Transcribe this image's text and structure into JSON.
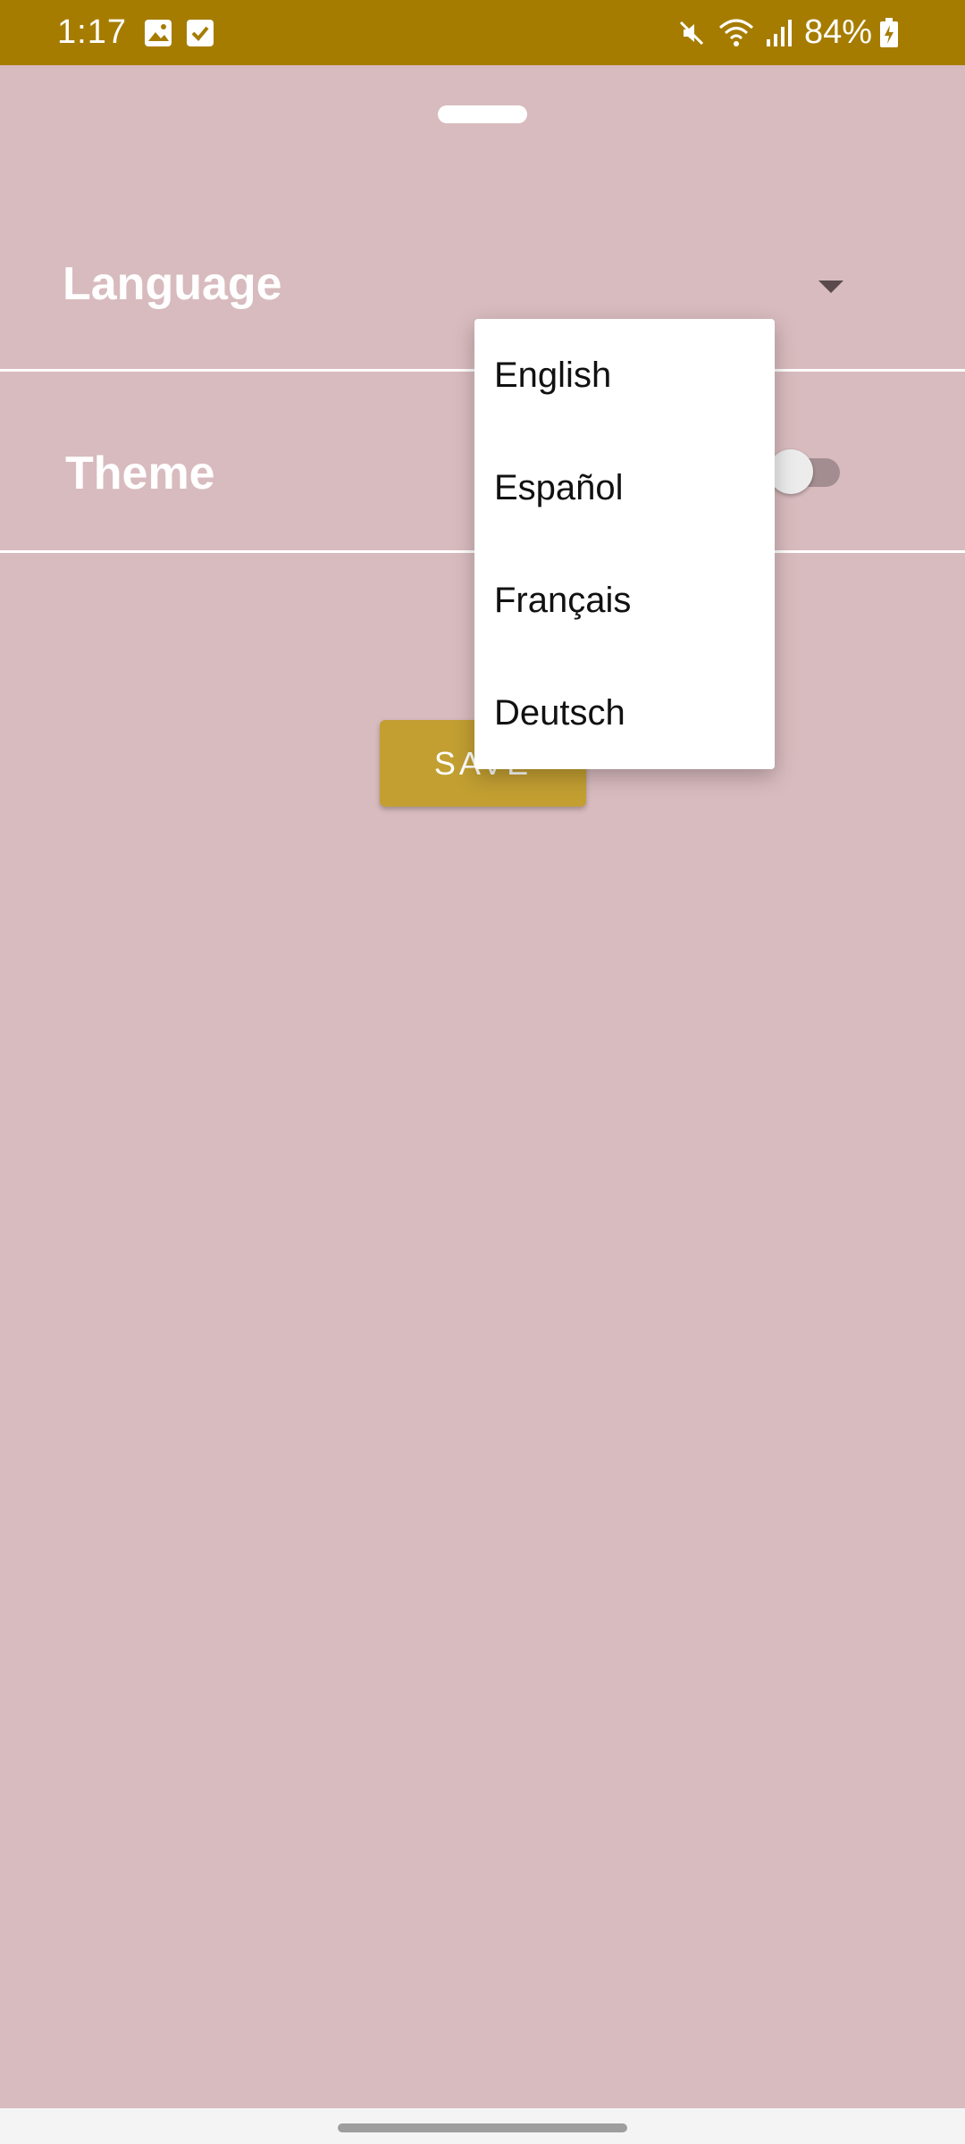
{
  "status_bar": {
    "time": "1:17",
    "battery": "84%",
    "icons_left": [
      "image-icon",
      "check-square-icon"
    ],
    "icons_right": [
      "mute-icon",
      "wifi-icon",
      "signal-icon",
      "battery-charging-icon"
    ],
    "background": "#a67c00"
  },
  "settings": {
    "language_label": "Language",
    "theme_label": "Theme",
    "theme_enabled": false,
    "save_label": "SAVE"
  },
  "language_dropdown": {
    "options": [
      "English",
      "Español",
      "Français",
      "Deutsch"
    ]
  },
  "colors": {
    "background": "#d8bbbe",
    "accent": "#c39f32",
    "status_bar": "#a67c00"
  }
}
